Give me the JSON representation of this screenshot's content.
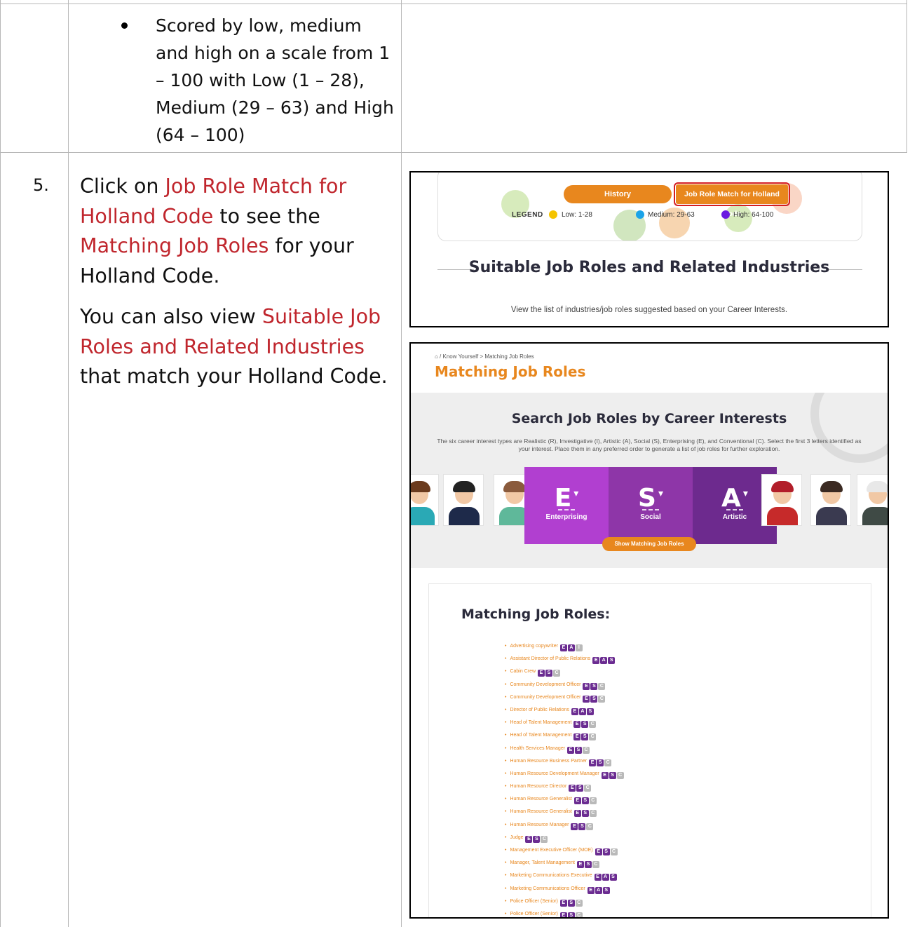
{
  "doc": {
    "bullet": "Scored by low, medium and high on a scale from 1 – 100 with Low (1 – 28), Medium (29 – 63) and High (64 – 100)",
    "step_number": "5.",
    "para1": {
      "pre": "Click on ",
      "link1": "Job Role Match for Holland Code",
      "mid": " to see the ",
      "link2": "Matching Job Roles",
      "post": " for your Holland Code."
    },
    "para2": {
      "pre": "You can also view ",
      "link": "Suitable Job Roles and Related Industries",
      "post": " that match your Holland Code."
    }
  },
  "screenshot1": {
    "history_button": "History",
    "job_role_button": "Job Role Match for Holland Code",
    "legend_title": "LEGEND",
    "legend": [
      {
        "label": "Low: 1-28",
        "color": "#f5c400"
      },
      {
        "label": "Medium: 29-63",
        "color": "#1aa3e8"
      },
      {
        "label": "High: 64-100",
        "color": "#6a1be0"
      }
    ],
    "section_title": "Suitable Job Roles and Related Industries",
    "section_subtitle": "View the list of industries/job roles suggested based on your Career Interests."
  },
  "screenshot2": {
    "breadcrumb": "⌂ / Know Yourself > Matching Job Roles",
    "page_title": "Matching Job Roles",
    "search_title": "Search Job Roles by Career Interests",
    "search_desc": "The six career interest types are Realistic (R), Investigative (I), Artistic (A), Social (S), Enterprising (E), and Conventional (C). Select the first 3 letters identified as your interest. Place them in any preferred order to generate a list of job roles for further exploration.",
    "codes": [
      {
        "letter": "E",
        "name": "Enterprising",
        "color": "#b13fd0"
      },
      {
        "letter": "S",
        "name": "Social",
        "color": "#8e36a8"
      },
      {
        "letter": "A",
        "name": "Artistic",
        "color": "#6d2a8e"
      }
    ],
    "show_button": "Show Matching Job Roles",
    "list_title": "Matching Job Roles:",
    "roles": [
      {
        "name": "Advertising copywriter",
        "tags": [
          "E",
          "A",
          "I"
        ],
        "on": [
          true,
          true,
          false
        ]
      },
      {
        "name": "Assistant Director of Public Relations",
        "tags": [
          "E",
          "A",
          "S"
        ],
        "on": [
          true,
          true,
          true
        ]
      },
      {
        "name": "Cabin Crew",
        "tags": [
          "E",
          "S",
          "C"
        ],
        "on": [
          true,
          true,
          false
        ]
      },
      {
        "name": "Community Development Officer",
        "tags": [
          "E",
          "S",
          "C"
        ],
        "on": [
          true,
          true,
          false
        ]
      },
      {
        "name": "Community Development Officer",
        "tags": [
          "E",
          "S",
          "C"
        ],
        "on": [
          true,
          true,
          false
        ]
      },
      {
        "name": "Director of Public Relations",
        "tags": [
          "E",
          "A",
          "S"
        ],
        "on": [
          true,
          true,
          true
        ]
      },
      {
        "name": "Head of Talent Management",
        "tags": [
          "E",
          "S",
          "C"
        ],
        "on": [
          true,
          true,
          false
        ]
      },
      {
        "name": "Head of Talent Management",
        "tags": [
          "E",
          "S",
          "C"
        ],
        "on": [
          true,
          true,
          false
        ]
      },
      {
        "name": "Health Services Manager",
        "tags": [
          "E",
          "S",
          "C"
        ],
        "on": [
          true,
          true,
          false
        ]
      },
      {
        "name": "Human Resource Business Partner",
        "tags": [
          "E",
          "S",
          "C"
        ],
        "on": [
          true,
          true,
          false
        ]
      },
      {
        "name": "Human Resource Development Manager",
        "tags": [
          "E",
          "S",
          "C"
        ],
        "on": [
          true,
          true,
          false
        ]
      },
      {
        "name": "Human Resource Director",
        "tags": [
          "E",
          "S",
          "C"
        ],
        "on": [
          true,
          true,
          false
        ]
      },
      {
        "name": "Human Resource Generalist",
        "tags": [
          "E",
          "S",
          "C"
        ],
        "on": [
          true,
          true,
          false
        ]
      },
      {
        "name": "Human Resource Generalist",
        "tags": [
          "E",
          "S",
          "C"
        ],
        "on": [
          true,
          true,
          false
        ]
      },
      {
        "name": "Human Resource Manager",
        "tags": [
          "E",
          "S",
          "C"
        ],
        "on": [
          true,
          true,
          false
        ]
      },
      {
        "name": "Judge",
        "tags": [
          "E",
          "S",
          "C"
        ],
        "on": [
          true,
          true,
          false
        ]
      },
      {
        "name": "Management Executive Officer (MOE)",
        "tags": [
          "E",
          "S",
          "C"
        ],
        "on": [
          true,
          true,
          false
        ]
      },
      {
        "name": "Manager, Talent Management",
        "tags": [
          "E",
          "S",
          "C"
        ],
        "on": [
          true,
          true,
          false
        ]
      },
      {
        "name": "Marketing Communications Executive",
        "tags": [
          "E",
          "A",
          "S"
        ],
        "on": [
          true,
          true,
          true
        ]
      },
      {
        "name": "Marketing Communications Officer",
        "tags": [
          "E",
          "A",
          "S"
        ],
        "on": [
          true,
          true,
          true
        ]
      },
      {
        "name": "Police Officer (Senior)",
        "tags": [
          "E",
          "S",
          "C"
        ],
        "on": [
          true,
          true,
          false
        ]
      },
      {
        "name": "Police Officer (Senior)",
        "tags": [
          "E",
          "S",
          "C"
        ],
        "on": [
          true,
          true,
          false
        ]
      }
    ]
  }
}
